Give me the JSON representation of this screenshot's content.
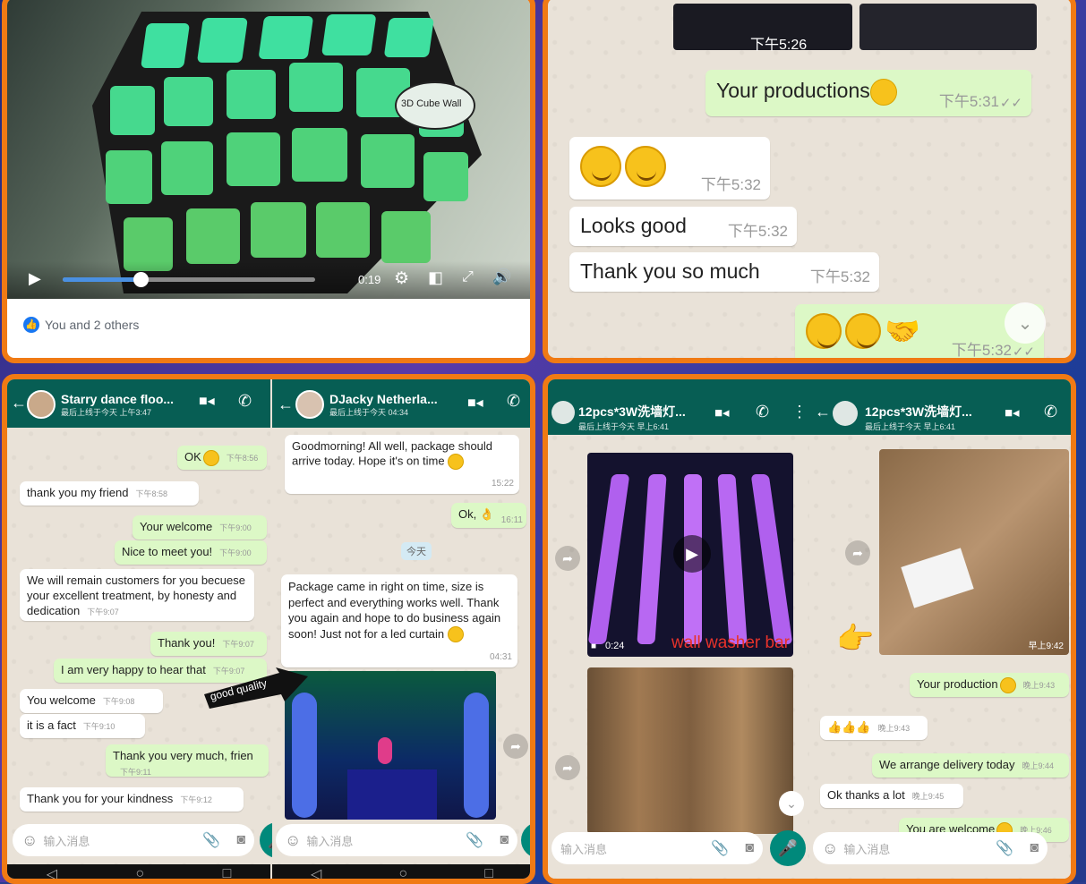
{
  "tl": {
    "cube_label": "3D Cube Wall",
    "time": "0:19",
    "likes": "You and 2 others",
    "progress_fraction": 0.31
  },
  "tr": {
    "top_time": "下午5:26",
    "m1": {
      "text": "Your productions",
      "time": "下午5:31"
    },
    "m2": {
      "time": "下午5:32"
    },
    "m3": {
      "text": "Looks good",
      "time": "下午5:32"
    },
    "m4": {
      "text": "Thank you so much",
      "time": "下午5:32"
    },
    "m5": {
      "time": "下午5:32"
    }
  },
  "bl": {
    "left": {
      "name": "Starry dance floo...",
      "sub": "最后上线于今天 上午3:47",
      "input_placeholder": "输入消息",
      "msgs": [
        {
          "text": "OK",
          "time": "下午8:56",
          "dir": "out"
        },
        {
          "text": "thank you my friend",
          "time": "下午8:58",
          "dir": "in"
        },
        {
          "text": "Your welcome",
          "time": "下午9:00",
          "dir": "out"
        },
        {
          "text": "Nice to meet you!",
          "time": "下午9:00",
          "dir": "out"
        },
        {
          "text": "We will remain customers for you becuese your excellent treatment, by honesty and dedication",
          "time": "下午9:07",
          "dir": "in"
        },
        {
          "text": "Thank you!",
          "time": "下午9:07",
          "dir": "out"
        },
        {
          "text": "I am very happy to hear that",
          "time": "下午9:07",
          "dir": "out"
        },
        {
          "text": "You welcome",
          "time": "下午9:08",
          "dir": "in"
        },
        {
          "text": "it is a fact",
          "time": "下午9:10",
          "dir": "in"
        },
        {
          "text": "Thank you very much, frien",
          "time": "下午9:11",
          "dir": "out"
        },
        {
          "text": "Thank you for your kindness",
          "time": "下午9:12",
          "dir": "in"
        }
      ]
    },
    "right": {
      "name": "DJacky Netherla...",
      "sub": "最后上线于今天 04:34",
      "input_placeholder": "输入消息",
      "m1": {
        "text": "Goodmorning! All well, package should arrive today. Hope it's on time",
        "time": "15:22"
      },
      "m2": {
        "text": "Ok,",
        "time": "16:11"
      },
      "date": "今天",
      "m3": {
        "text": "Package came in right on time, size is perfect and everything works well. Thank you again and hope to do business again soon! Just not for a led curtain",
        "time": "04:31"
      },
      "arrow_label": "good quality"
    }
  },
  "br": {
    "left": {
      "name": "12pcs*3W洗墙灯...",
      "sub": "最后上线于今天 早上6:41",
      "video_time": "0:24",
      "video_caption": "wall washer bar",
      "input_placeholder": "输入消息"
    },
    "right": {
      "name": "12pcs*3W洗墙灯...",
      "sub": "最后上线于今天 早上6:41",
      "img_time": "早上9:42",
      "input_placeholder": "输入消息",
      "msgs": [
        {
          "text": "Your production",
          "time": "晚上9:43",
          "dir": "out"
        },
        {
          "text": "",
          "time": "晚上9:43",
          "dir": "in"
        },
        {
          "text": "We arrange delivery today",
          "time": "晚上9:44",
          "dir": "out"
        },
        {
          "text": "Ok thanks a lot",
          "time": "晚上9:45",
          "dir": "in"
        },
        {
          "text": "You are welcome",
          "time": "晚上9:46",
          "dir": "out"
        }
      ]
    }
  }
}
